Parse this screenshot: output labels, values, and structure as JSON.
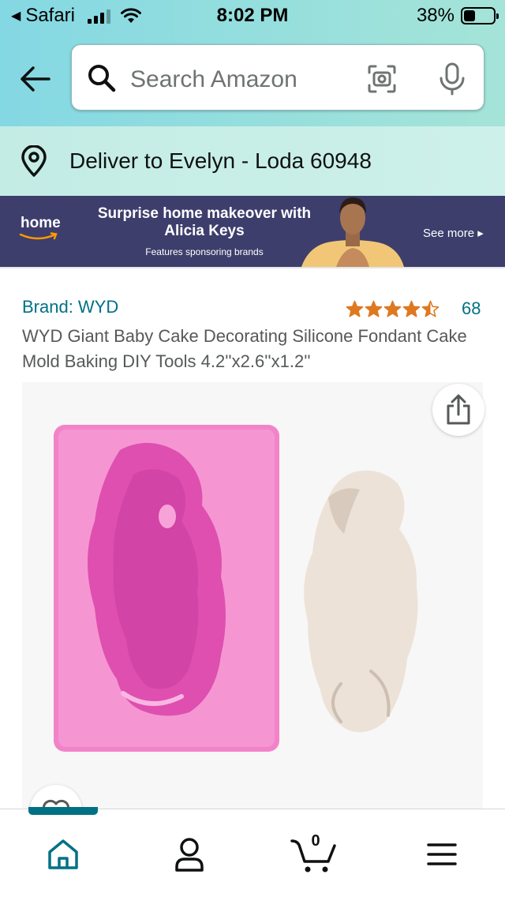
{
  "status_bar": {
    "carrier": "Safari",
    "time": "8:02 PM",
    "battery": "38%",
    "battery_level": 0.38,
    "signal_bars": 3
  },
  "header": {
    "back_icon": "arrow-left-icon",
    "search_placeholder": "Search Amazon",
    "search_icon": "search-icon",
    "camera_icon": "camera-scan-icon",
    "mic_icon": "microphone-icon"
  },
  "deliver": {
    "icon": "location-pin-icon",
    "text": "Deliver to Evelyn - Loda 60948"
  },
  "banner": {
    "logo": "home",
    "headline": "Surprise home makeover with Alicia Keys",
    "subtext": "Features sponsoring brands",
    "see_more": "See more ▸"
  },
  "product": {
    "brand": "Brand: WYD",
    "rating": 4.5,
    "rating_count": "68",
    "title": "WYD Giant Baby Cake Decorating Silicone Fondant Cake Mold Baking DIY Tools 4.2''x2.6''x1.2''",
    "share_icon": "share-icon",
    "wishlist_icon": "heart-icon"
  },
  "tabbar": {
    "items": [
      {
        "name": "home",
        "icon": "home-icon",
        "active": true
      },
      {
        "name": "you",
        "icon": "person-icon",
        "active": false
      },
      {
        "name": "cart",
        "icon": "cart-icon",
        "active": false,
        "count": "0"
      },
      {
        "name": "menu",
        "icon": "menu-icon",
        "active": false
      }
    ]
  },
  "colors": {
    "accent": "#007185",
    "star": "#de7921",
    "banner_bg": "#3d3e6c"
  }
}
